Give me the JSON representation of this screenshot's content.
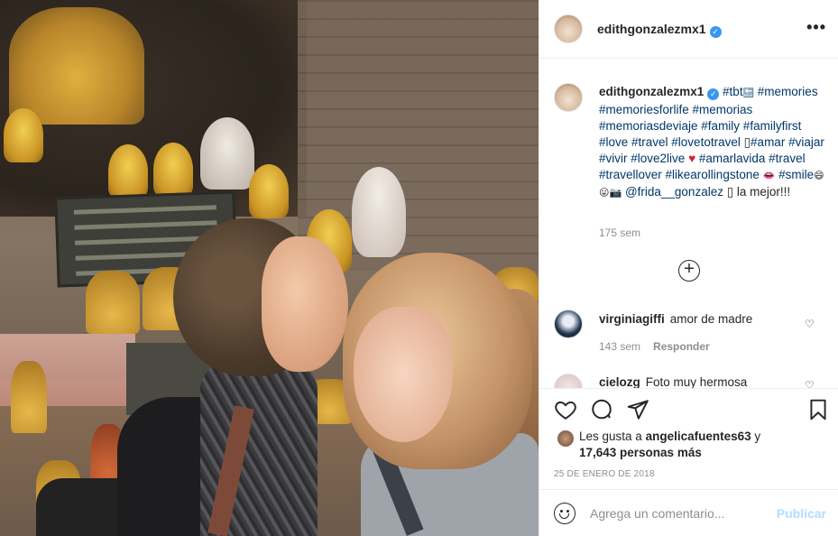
{
  "post": {
    "username": "edithgonzalezmx1",
    "verified_mark": "✓",
    "more_glyph": "•••"
  },
  "caption": {
    "username": "edithgonzalezmx1",
    "text_start": "#tbt",
    "back_glyph": "🔙",
    "hashtags_1": "#memories #memoriesforlife #memorias #memoriasdeviaje #family #familyfirst #love #travel #lovetotravel",
    "box_glyph": "▯",
    "hashtags_2": "#amar #viajar #vivir #love2live",
    "heart": "♥",
    "hashtags_3": "#amarlavida #travel #travellover #likearollingstone",
    "lips": "👄",
    "smile_tag": "#smile",
    "smile_emojis": "😄😛📷",
    "mention": "@frida__gonzalez",
    "end_text": "▯ la mejor!!!",
    "age": "175 sem"
  },
  "load_more_icon": "+",
  "comments": [
    {
      "username": "virginiagiffi",
      "text": "amor de madre",
      "age": "143 sem",
      "reply": "Responder"
    },
    {
      "username": "cielozg",
      "text": "Foto muy hermosa"
    }
  ],
  "likes": {
    "prefix": "Les gusta a",
    "user": "angelicafuentes63",
    "connector": "y",
    "count": "17,643 personas más"
  },
  "date": "25 DE ENERO DE 2018",
  "add_comment": {
    "placeholder": "Agrega un comentario...",
    "publish": "Publicar"
  },
  "colors": {
    "link": "#00376b",
    "verified": "#3897f0",
    "publish_disabled": "#b3dbff",
    "meta": "#8e8e8e"
  }
}
